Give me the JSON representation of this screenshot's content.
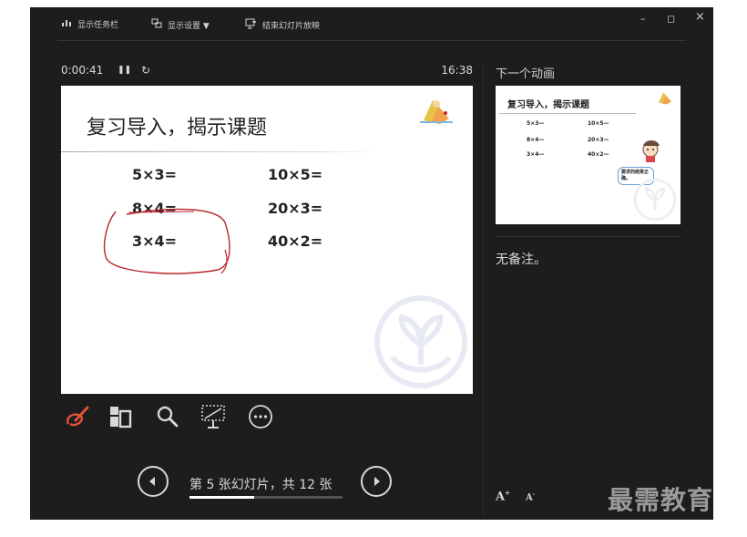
{
  "toolbar": {
    "taskbar_label": "显示任务栏",
    "display_settings_label": "显示设置 ▼",
    "end_show_label": "结束幻灯片放映"
  },
  "window_controls": {
    "minimize": "–",
    "restore": "◻",
    "close": "×"
  },
  "timer": {
    "elapsed": "0:00:41",
    "pause_icon": "❚❚",
    "reset_icon": "↻",
    "clock": "16:38"
  },
  "slide": {
    "title": "复习导入，揭示课题",
    "equations": [
      "5×3=",
      "10×5=",
      "8×4=",
      "20×3=",
      "3×4=",
      "40×2="
    ]
  },
  "tools": [
    "pen-icon",
    "slide-grid-icon",
    "zoom-icon",
    "screen-icon",
    "more-options-icon"
  ],
  "navigation": {
    "slide_counter": "第 5 张幻灯片，共 12 张",
    "current": 5,
    "total": 12,
    "progress": 0.42
  },
  "sidebar": {
    "next_label": "下一个动画",
    "next_preview": {
      "title": "复习导入，揭示课题",
      "equations": [
        "5×3—",
        "10×5—",
        "8×4—",
        "20×3—",
        "3×4—",
        "40×2—"
      ],
      "bubble": "要求的结果正确。"
    },
    "notes": "无备注。",
    "font_larger": "A",
    "font_smaller": "A"
  },
  "brand": "最需教育",
  "colors": {
    "background": "#1f1c1d",
    "pen_active": "#e0533a",
    "ink_red": "#b8262b"
  }
}
